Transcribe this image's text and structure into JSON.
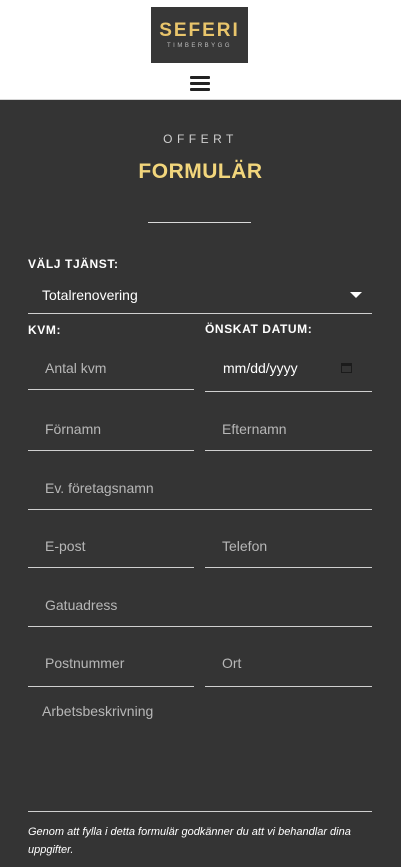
{
  "header": {
    "logo_main": "SEFERI",
    "logo_sub": "TIMBERBYGG",
    "menu_icon": "hamburger-menu-icon"
  },
  "hero": {
    "eyebrow": "OFFERT",
    "title": "FORMULÄR"
  },
  "form": {
    "service_label": "VÄLJ TJÄNST:",
    "service_value": "Totalrenovering",
    "kvm_label": "KVM:",
    "date_label": "ÖNSKAT DATUM:",
    "kvm_placeholder": "Antal kvm",
    "date_value": "mm/dd/yyyy",
    "first_name_placeholder": "Förnamn",
    "last_name_placeholder": "Efternamn",
    "company_placeholder": "Ev. företagsnamn",
    "email_placeholder": "E-post",
    "phone_placeholder": "Telefon",
    "address_placeholder": "Gatuadress",
    "postcode_placeholder": "Postnummer",
    "city_placeholder": "Ort",
    "description_placeholder": "Arbetsbeskrivning",
    "consent_text": "Genom att fylla i detta formulär godkänner du att vi behandlar dina uppgifter."
  },
  "colors": {
    "background": "#343434",
    "accent_gold": "#f2d67c",
    "header_bg": "#ffffff"
  }
}
